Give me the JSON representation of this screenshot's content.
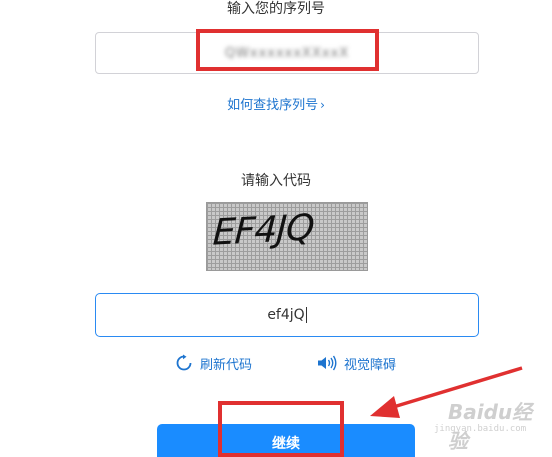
{
  "serial": {
    "title": "输入您的序列号",
    "value": "QWxxxxxxXXxxX"
  },
  "find_link": {
    "label": "如何查找序列号",
    "chevron": "›"
  },
  "code": {
    "title": "请输入代码",
    "captcha_text": "EF4JQ",
    "input_value": "ef4jQ"
  },
  "actions": {
    "refresh_label": "刷新代码",
    "audio_label": "视觉障碍",
    "continue_label": "继续"
  },
  "watermark": {
    "main": "Baidu经验",
    "sub": "jingyan.baidu.com"
  },
  "colors": {
    "link": "#1d74cf",
    "primary": "#1a8cff",
    "annotation": "#e03030",
    "input_focus": "#2a8af2"
  },
  "icons": {
    "refresh": "refresh-icon",
    "audio": "speaker-icon",
    "chevron": "chevron-right-icon"
  }
}
